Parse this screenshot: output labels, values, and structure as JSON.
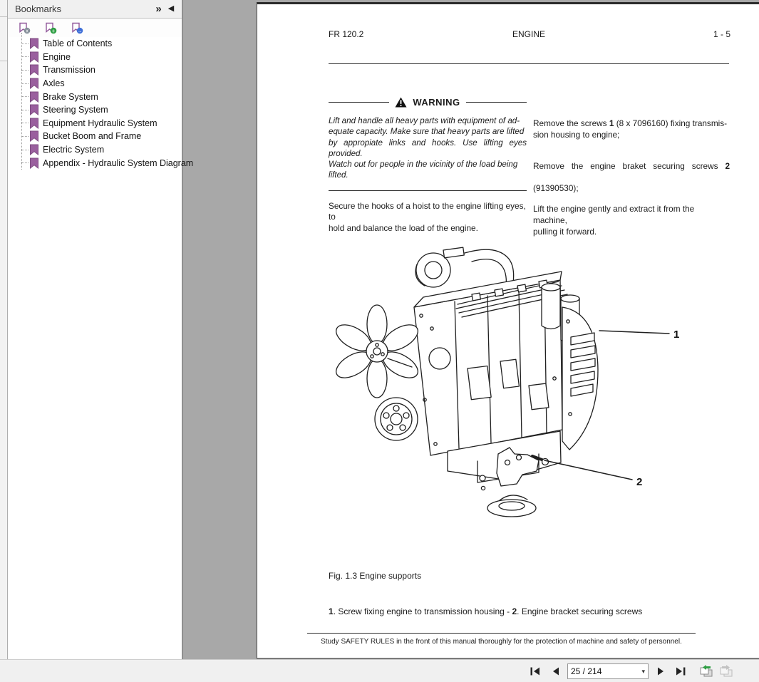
{
  "colors": {
    "bookmark_purple": "#91589b",
    "canvas_gray": "#a8a8a8",
    "chrome_gray": "#f0f0f0",
    "badge_delete": "#848e98",
    "badge_new": "#2e9e43",
    "badge_goto": "#3f6fd8"
  },
  "sidebar": {
    "title": "Bookmarks",
    "header_icons": {
      "expand": "»",
      "collapse": "◀"
    },
    "toolbar_icons": [
      {
        "name": "delete-bookmark",
        "symbol": "×"
      },
      {
        "name": "new-bookmark",
        "symbol": "+"
      },
      {
        "name": "goto-bookmark",
        "symbol": "→"
      }
    ],
    "items": [
      "Table of Contents",
      "Engine",
      "Transmission",
      "Axles",
      "Brake System",
      "Steering System",
      "Equipment Hydraulic System",
      "Bucket Boom and Frame",
      "Electric System",
      "Appendix - Hydraulic System Diagram"
    ]
  },
  "page": {
    "header": {
      "left": "FR 120.2",
      "center": "ENGINE",
      "right": "1 - 5"
    },
    "warning": {
      "title": "WARNING",
      "body": "Lift and handle all heavy parts with equipment of ad-\nequate capacity. Make sure that heavy parts are lifted\nby appropiate links and hooks. Use lifting eyes provided.\nWatch out for people in the vicinity of the load being\nlifted."
    },
    "secure_text": "Secure the hooks of a hoist to the engine lifting eyes, to\nhold and balance the load of the engine.",
    "col_right": {
      "p1_pre": "Remove the screws ",
      "p1_num": "1",
      "p1_post": " (8 x 7096160) fixing transmis-\nsion housing to engine;",
      "p2_pre": "Remove the engine braket securing screws ",
      "p2_num": "2",
      "p2_line2": "(91390530);",
      "p3": "Lift the engine gently and extract it from the machine,\npulling it forward."
    },
    "figure": {
      "callout1": "1",
      "callout2": "2",
      "caption": "Fig. 1.3 Engine supports"
    },
    "parts_caption": {
      "n1": "1",
      "t1": ". Screw fixing engine to transmission housing - ",
      "n2": "2",
      "t2": ". Engine bracket securing screws"
    },
    "footer": "Study SAFETY RULES in the front of this manual thoroughly for the protection of machine and safety of personnel."
  },
  "navbar": {
    "page_value": "25 / 214"
  }
}
